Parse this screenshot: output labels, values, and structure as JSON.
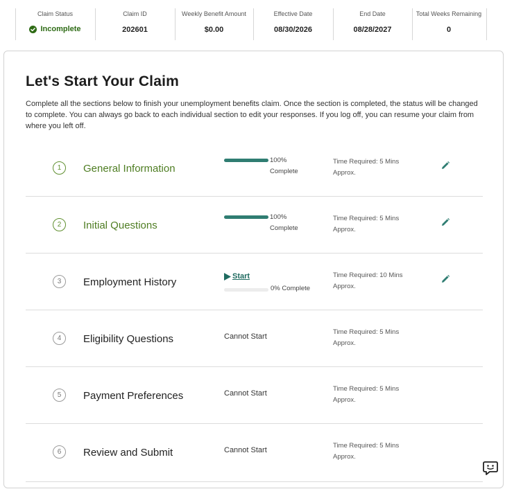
{
  "summary": {
    "claim_status": {
      "label": "Claim Status",
      "value": "Incomplete",
      "icon": "check-circle-icon",
      "color": "#2e6b15"
    },
    "claim_id": {
      "label": "Claim ID",
      "value": "202601"
    },
    "weekly_benefit": {
      "label": "Weekly Benefit Amount",
      "value": "$0.00"
    },
    "effective_date": {
      "label": "Effective Date",
      "value": "08/30/2026"
    },
    "end_date": {
      "label": "End Date",
      "value": "08/28/2027"
    },
    "weeks_remaining": {
      "label": "Total Weeks Remaining",
      "value": "0"
    }
  },
  "main": {
    "title": "Let's Start Your Claim",
    "intro": "Complete all the sections below to finish your unemployment benefits claim. Once the section is completed, the status will be changed to complete. You can always go back to each individual section to edit your responses. If you log off, you can resume your claim from where you left off."
  },
  "sections": [
    {
      "number": "1",
      "name": "General Information",
      "state": "complete",
      "progress": 1.0,
      "progress_pct": "100%",
      "progress_word": "Complete",
      "time": "Time Required: 5 Mins Approx.",
      "editable": true
    },
    {
      "number": "2",
      "name": "Initial Questions",
      "state": "complete",
      "progress": 1.0,
      "progress_pct": "100%",
      "progress_word": "Complete",
      "time": "Time Required: 5 Mins Approx.",
      "editable": true
    },
    {
      "number": "3",
      "name": "Employment History",
      "state": "start",
      "progress": 0.0,
      "start_label": "Start",
      "progress_text": "0% Complete",
      "time": "Time Required: 10 Mins Approx.",
      "editable": true
    },
    {
      "number": "4",
      "name": "Eligibility Questions",
      "state": "locked",
      "status_text": "Cannot Start",
      "time": "Time Required: 5 Mins Approx.",
      "editable": false
    },
    {
      "number": "5",
      "name": "Payment Preferences",
      "state": "locked",
      "status_text": "Cannot Start",
      "time": "Time Required: 5 Mins Approx.",
      "editable": false
    },
    {
      "number": "6",
      "name": "Review and Submit",
      "state": "locked",
      "status_text": "Cannot Start",
      "time": "Time Required: 5 Mins Approx.",
      "editable": false
    }
  ],
  "colors": {
    "accent": "#2f7d72",
    "complete_text": "#4e7d22",
    "status_green": "#2e6b15"
  },
  "icons": {
    "edit": "pencil-icon",
    "start": "play-icon",
    "chat": "chat-assistant-icon"
  }
}
